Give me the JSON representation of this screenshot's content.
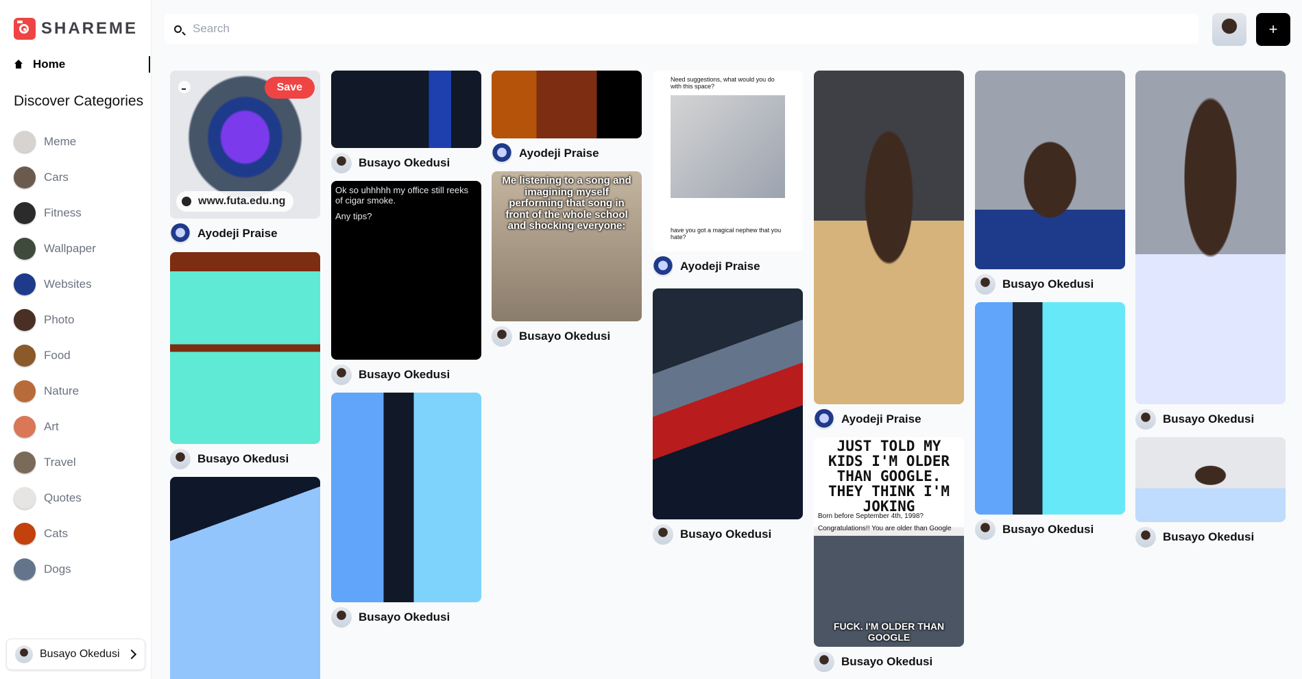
{
  "app": {
    "logo_text": "SHAREME"
  },
  "sidebar": {
    "home_label": "Home",
    "categories_heading": "Discover Categories",
    "categories": [
      {
        "label": "Meme",
        "color": "#d6d3d1"
      },
      {
        "label": "Cars",
        "color": "#6b5b4e"
      },
      {
        "label": "Fitness",
        "color": "#2b2b2b"
      },
      {
        "label": "Wallpaper",
        "color": "#3f4a3c"
      },
      {
        "label": "Websites",
        "color": "#1e3a8a"
      },
      {
        "label": "Photo",
        "color": "#4a2f25"
      },
      {
        "label": "Food",
        "color": "#8a5a2b"
      },
      {
        "label": "Nature",
        "color": "#b86b3a"
      },
      {
        "label": "Art",
        "color": "#d97757"
      },
      {
        "label": "Travel",
        "color": "#7a6a5a"
      },
      {
        "label": "Quotes",
        "color": "#e7e5e4"
      },
      {
        "label": "Cats",
        "color": "#c2410c"
      },
      {
        "label": "Dogs",
        "color": "#64748b"
      }
    ],
    "user_name": "Busayo Okedusi"
  },
  "header": {
    "search_placeholder": "Search",
    "add_label": "+"
  },
  "pins": {
    "p1": {
      "save_label": "Save",
      "link_text": "www.futa.edu.ng",
      "author": "Ayodeji Praise"
    },
    "p2": {
      "author": "Busayo Okedusi"
    },
    "p3": {
      "author": "Busayo Okedusi"
    },
    "p4": {
      "author": "Busayo Okedusi"
    },
    "p5": {
      "author": "Busayo Okedusi",
      "tweet_text": "Ok so uhhhhh my office still reeks of cigar smoke.",
      "tweet_text2": "Any tips?"
    },
    "p6": {
      "author": "Busayo Okedusi"
    },
    "p7": {
      "author": "Ayodeji Praise"
    },
    "p8": {
      "author": "Busayo Okedusi",
      "caption": "Me listening to a song and imagining myself performing that song in front of the whole school and shocking everyone:"
    },
    "p9": {
      "author": "Ayodeji Praise",
      "top_text": "Need suggestions, what would you do with this space?",
      "bottom_text": "have you got a magical nephew that you hate?"
    },
    "p10": {
      "author": "Busayo Okedusi"
    },
    "p11": {
      "author": "Ayodeji Praise"
    },
    "p12": {
      "author": "Busayo Okedusi",
      "headline": "JUST TOLD MY KIDS I'M OLDER THAN GOOGLE. THEY THINK I'M JOKING",
      "sub1": "Born before September 4th, 1998?",
      "sub2": "Congratulations!! You are older than Google",
      "bottom": "FUCK. I'M OLDER THAN GOOGLE"
    },
    "p13": {
      "author": "Busayo Okedusi"
    },
    "p14": {
      "author": "Busayo Okedusi"
    },
    "p15": {
      "author": "Busayo Okedusi"
    },
    "p16": {
      "author": "Busayo Okedusi"
    }
  }
}
